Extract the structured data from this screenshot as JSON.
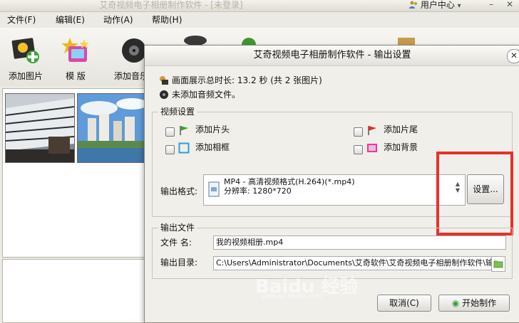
{
  "window": {
    "title": "艾奇视频电子相册制作软件 - [未登录]",
    "user_center": "用户中心",
    "user_center_arrow": "▾",
    "minimize": "–",
    "close": "✕"
  },
  "menu": [
    "文件(F)",
    "编辑(E)",
    "动作(A)",
    "帮助(H)"
  ],
  "toolbar": [
    {
      "label": "添加图片",
      "icon": "add-picture-icon"
    },
    {
      "label": "模 版",
      "icon": "template-icon"
    },
    {
      "label": "添加音乐",
      "icon": "add-music-icon"
    }
  ],
  "dialog": {
    "title": "艾奇视频电子相册制作软件 - 输出设置",
    "close": "✕",
    "total_duration": "画面展示总时长: 13.2 秒 (共 2 张图片)",
    "no_audio": "未添加音频文件。",
    "video_settings": {
      "title": "视频设置",
      "options": [
        {
          "label": "添加片头",
          "icon": "green-flag-icon"
        },
        {
          "label": "添加片尾",
          "icon": "red-flag-icon"
        },
        {
          "label": "添加相框",
          "icon": "frame-icon"
        },
        {
          "label": "添加背景",
          "icon": "background-icon"
        }
      ],
      "format_label": "输出格式:",
      "format_line1": "MP4 - 高清视频格式(H.264)(*.mp4)",
      "format_line2": "分辨率: 1280*720",
      "settings_button": "设置..."
    },
    "output_file": {
      "title": "输出文件",
      "filename_label": "文件 名:",
      "filename_value": "我的视频相册.mp4",
      "dir_label": "输出目录:",
      "dir_value": "C:\\Users\\Administrator\\Documents\\艾奇软件\\艾奇视频电子相册制作软件\\输出"
    },
    "cancel_button": "取消(C)",
    "start_button": "开始制作"
  },
  "watermark": {
    "text": "Baidu 经验",
    "sub": "jingyan.baidu.com"
  },
  "colors": {
    "highlight_box": "#e8302b",
    "chrome": "#eceae4"
  }
}
